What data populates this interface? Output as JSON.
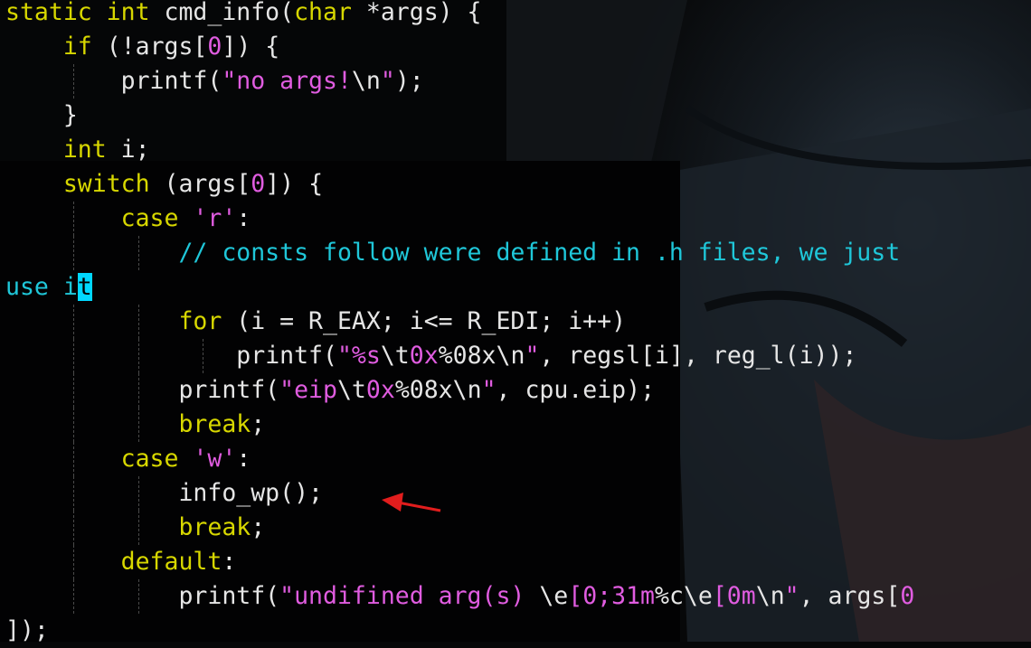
{
  "editor": {
    "theme": {
      "keyword": "#d7d700",
      "string": "#e05ce0",
      "comment": "#1fc7d9",
      "plain": "#e6e6e6",
      "cursor": "#00d7ff"
    },
    "annotation": {
      "icon": "red-arrow-icon",
      "color": "#e11d1d"
    },
    "lines": [
      {
        "indent": 0,
        "tokens": [
          {
            "t": "static int",
            "c": "keyword"
          },
          {
            "t": " cmd_info(",
            "c": "plain"
          },
          {
            "t": "char",
            "c": "keyword"
          },
          {
            "t": " *args) {",
            "c": "plain"
          }
        ]
      },
      {
        "indent": 1,
        "tokens": [
          {
            "t": "if",
            "c": "keyword"
          },
          {
            "t": " (!args[",
            "c": "plain"
          },
          {
            "t": "0",
            "c": "string"
          },
          {
            "t": "]) {",
            "c": "plain"
          }
        ]
      },
      {
        "indent": 2,
        "tokens": [
          {
            "t": "printf(",
            "c": "plain"
          },
          {
            "t": "\"no args!",
            "c": "string"
          },
          {
            "t": "\\n",
            "c": "plain"
          },
          {
            "t": "\"",
            "c": "string"
          },
          {
            "t": ");",
            "c": "plain"
          }
        ]
      },
      {
        "indent": 1,
        "tokens": [
          {
            "t": "}",
            "c": "plain"
          }
        ]
      },
      {
        "indent": 1,
        "tokens": [
          {
            "t": "int",
            "c": "keyword"
          },
          {
            "t": " i;",
            "c": "plain"
          }
        ]
      },
      {
        "indent": 1,
        "tokens": [
          {
            "t": "switch",
            "c": "keyword"
          },
          {
            "t": " (args[",
            "c": "plain"
          },
          {
            "t": "0",
            "c": "string"
          },
          {
            "t": "]) {",
            "c": "plain"
          }
        ]
      },
      {
        "indent": 2,
        "tokens": [
          {
            "t": "case",
            "c": "keyword"
          },
          {
            "t": " ",
            "c": "plain"
          },
          {
            "t": "'r'",
            "c": "string"
          },
          {
            "t": ":",
            "c": "plain"
          }
        ]
      },
      {
        "indent": 3,
        "tokens": [
          {
            "t": "// consts follow were defined in .h files, we just",
            "c": "comment"
          }
        ]
      },
      {
        "indent": 0,
        "tokens": [
          {
            "t": "use i",
            "c": "comment"
          },
          {
            "t": "t",
            "c": "cursor"
          }
        ]
      },
      {
        "indent": 3,
        "tokens": [
          {
            "t": "for",
            "c": "keyword"
          },
          {
            "t": " (i = R_EAX; i<= R_EDI; i++)",
            "c": "plain"
          }
        ]
      },
      {
        "indent": 4,
        "tokens": [
          {
            "t": "printf(",
            "c": "plain"
          },
          {
            "t": "\"%s",
            "c": "string"
          },
          {
            "t": "\\t",
            "c": "plain"
          },
          {
            "t": "0x",
            "c": "string"
          },
          {
            "t": "%08x",
            "c": "plain"
          },
          {
            "t": "\\n",
            "c": "plain"
          },
          {
            "t": "\"",
            "c": "string"
          },
          {
            "t": ", regsl[i], reg_l(i));",
            "c": "plain"
          }
        ]
      },
      {
        "indent": 3,
        "tokens": [
          {
            "t": "printf(",
            "c": "plain"
          },
          {
            "t": "\"eip",
            "c": "string"
          },
          {
            "t": "\\t",
            "c": "plain"
          },
          {
            "t": "0x",
            "c": "string"
          },
          {
            "t": "%08x",
            "c": "plain"
          },
          {
            "t": "\\n",
            "c": "plain"
          },
          {
            "t": "\"",
            "c": "string"
          },
          {
            "t": ", cpu.eip);",
            "c": "plain"
          }
        ]
      },
      {
        "indent": 3,
        "tokens": [
          {
            "t": "break",
            "c": "keyword"
          },
          {
            "t": ";",
            "c": "plain"
          }
        ]
      },
      {
        "indent": 2,
        "tokens": [
          {
            "t": "case",
            "c": "keyword"
          },
          {
            "t": " ",
            "c": "plain"
          },
          {
            "t": "'w'",
            "c": "string"
          },
          {
            "t": ":",
            "c": "plain"
          }
        ]
      },
      {
        "indent": 3,
        "tokens": [
          {
            "t": "info_wp();",
            "c": "plain"
          }
        ]
      },
      {
        "indent": 3,
        "tokens": [
          {
            "t": "break",
            "c": "keyword"
          },
          {
            "t": ";",
            "c": "plain"
          }
        ]
      },
      {
        "indent": 2,
        "tokens": [
          {
            "t": "default",
            "c": "keyword"
          },
          {
            "t": ":",
            "c": "plain"
          }
        ]
      },
      {
        "indent": 3,
        "tokens": [
          {
            "t": "printf(",
            "c": "plain"
          },
          {
            "t": "\"undifined arg(s) ",
            "c": "string"
          },
          {
            "t": "\\e",
            "c": "plain"
          },
          {
            "t": "[0;31m",
            "c": "string"
          },
          {
            "t": "%c",
            "c": "plain"
          },
          {
            "t": "\\e",
            "c": "plain"
          },
          {
            "t": "[",
            "c": "string"
          },
          {
            "t": "0",
            "c": "string"
          },
          {
            "t": "m",
            "c": "string"
          },
          {
            "t": "\\n",
            "c": "plain"
          },
          {
            "t": "\"",
            "c": "string"
          },
          {
            "t": ", args[",
            "c": "plain"
          },
          {
            "t": "0",
            "c": "string"
          }
        ]
      },
      {
        "indent": 0,
        "tokens": [
          {
            "t": "]);",
            "c": "plain"
          }
        ]
      }
    ]
  }
}
